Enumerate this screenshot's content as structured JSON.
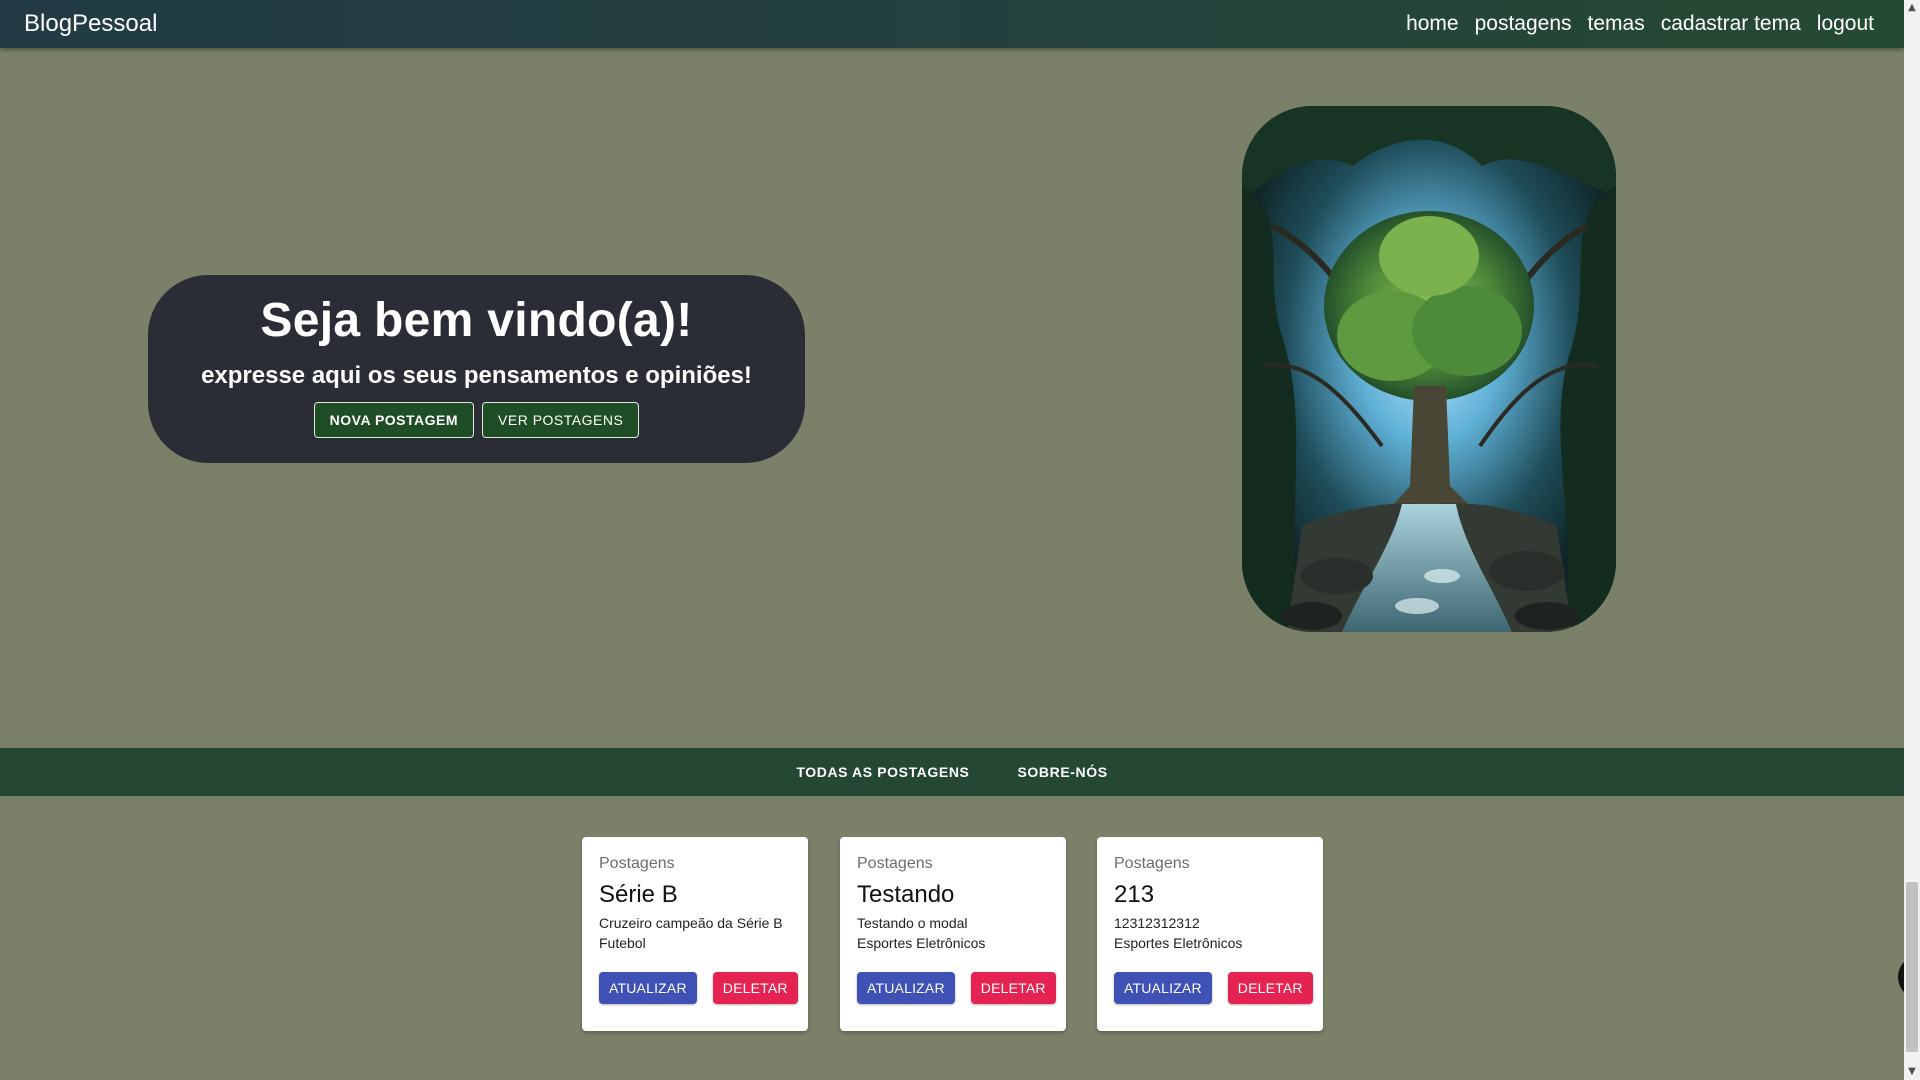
{
  "navbar": {
    "brand": "BlogPessoal",
    "links": [
      "home",
      "postagens",
      "temas",
      "cadastrar tema",
      "logout"
    ]
  },
  "hero": {
    "title": "Seja bem vindo(a)!",
    "subtitle": "expresse aqui os seus pensamentos e opiniões!",
    "new_post_label": "NOVA POSTAGEM",
    "view_posts_label": "VER POSTAGENS"
  },
  "tabs": [
    "TODAS AS POSTAGENS",
    "SOBRE-NÓS"
  ],
  "cards": [
    {
      "label": "Postagens",
      "title": "Série B",
      "text": "Cruzeiro campeão da Série B",
      "theme": "Futebol",
      "update_label": "ATUALIZAR",
      "delete_label": "DELETAR"
    },
    {
      "label": "Postagens",
      "title": "Testando",
      "text": "Testando o modal",
      "theme": "Esportes Eletrônicos",
      "update_label": "ATUALIZAR",
      "delete_label": "DELETAR"
    },
    {
      "label": "Postagens",
      "title": "213",
      "text": "12312312312",
      "theme": "Esportes Eletrônicos",
      "update_label": "ATUALIZAR",
      "delete_label": "DELETAR"
    }
  ],
  "colors": {
    "background": "#7b8068",
    "navbar": "#254a32",
    "welcome_box": "#2a2d36",
    "hero_button": "#1f4d26",
    "tabs_bar": "#244834",
    "update_button": "#3f51b5",
    "delete_button": "#e52352"
  },
  "icons": {
    "hero_image": "forest-tree-image",
    "side_widget": "chevron-left-icon"
  }
}
